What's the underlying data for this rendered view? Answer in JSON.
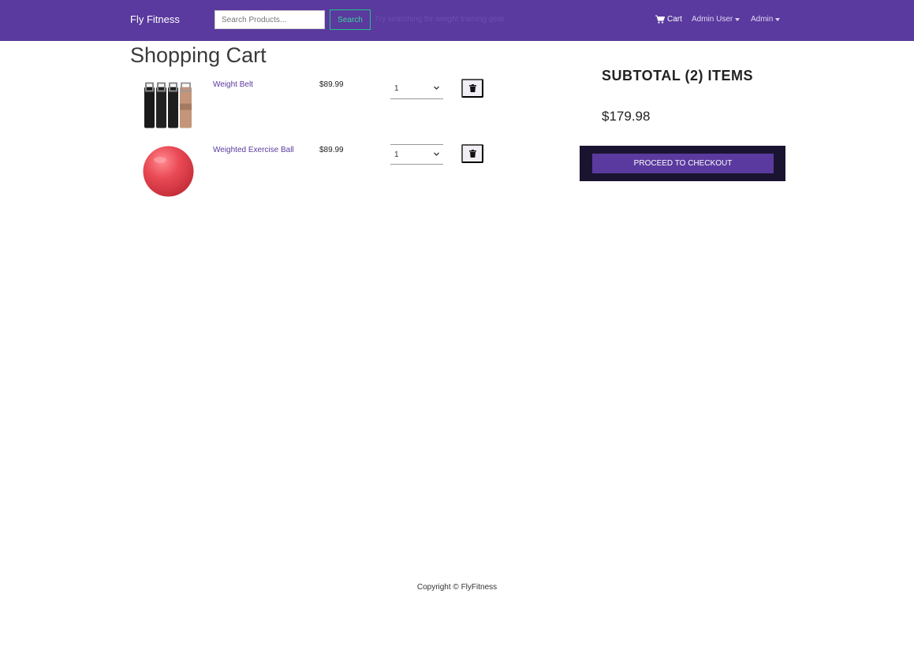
{
  "navbar": {
    "brand": "Fly Fitness",
    "search_placeholder": "Search Products...",
    "search_button": "Search",
    "search_hint": "Try searching for weight training gear",
    "cart_label": "Cart",
    "user_menu": "Admin User",
    "admin_menu": "Admin"
  },
  "page": {
    "title": "Shopping Cart"
  },
  "cart": {
    "items": [
      {
        "name": "Weight Belt",
        "price": "$89.99",
        "qty": "1",
        "image": "weight-belts"
      },
      {
        "name": "Weighted Exercise Ball",
        "price": "$89.99",
        "qty": "1",
        "image": "red-exercise-ball"
      }
    ]
  },
  "summary": {
    "title": "SUBTOTAL (2) ITEMS",
    "total": "$179.98",
    "checkout_label": "PROCEED TO CHECKOUT"
  },
  "footer": {
    "text": "Copyright © FlyFitness"
  },
  "colors": {
    "primary": "#5a3a9e",
    "success_outline": "#22c48a",
    "summary_bg": "#1b1430"
  },
  "icons": [
    "cart-icon",
    "chevron-down-icon",
    "trash-icon"
  ]
}
